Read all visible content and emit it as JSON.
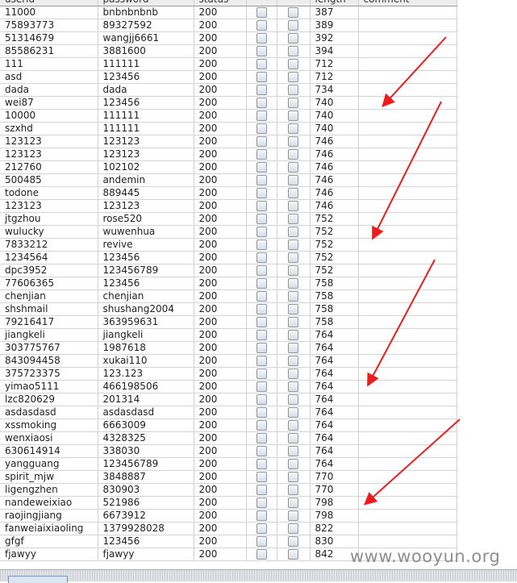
{
  "table": {
    "header": [
      "userid",
      "password",
      "status",
      "",
      "",
      "length",
      "comment"
    ],
    "rows": [
      [
        "11000",
        "bnbnbnbnb",
        "200",
        "387"
      ],
      [
        "75893773",
        "89327592",
        "200",
        "389"
      ],
      [
        "51314679",
        "wangjj6661",
        "200",
        "392"
      ],
      [
        "85586231",
        "3881600",
        "200",
        "394"
      ],
      [
        "111",
        "111111",
        "200",
        "712"
      ],
      [
        "asd",
        "123456",
        "200",
        "712"
      ],
      [
        "dada",
        "dada",
        "200",
        "734"
      ],
      [
        "wei87",
        "123456",
        "200",
        "740"
      ],
      [
        "10000",
        "111111",
        "200",
        "740"
      ],
      [
        "szxhd",
        "111111",
        "200",
        "740"
      ],
      [
        "123123",
        "123123",
        "200",
        "746"
      ],
      [
        "123123",
        "123123",
        "200",
        "746"
      ],
      [
        "212760",
        "102102",
        "200",
        "746"
      ],
      [
        "500485",
        "andemin",
        "200",
        "746"
      ],
      [
        "todone",
        "889445",
        "200",
        "746"
      ],
      [
        "123123",
        "123123",
        "200",
        "746"
      ],
      [
        "jtgzhou",
        "rose520",
        "200",
        "752"
      ],
      [
        "wulucky",
        "wuwenhua",
        "200",
        "752"
      ],
      [
        "7833212",
        "revive",
        "200",
        "752"
      ],
      [
        "1234564",
        "123456",
        "200",
        "752"
      ],
      [
        "dpc3952",
        "123456789",
        "200",
        "752"
      ],
      [
        "77606365",
        "123456",
        "200",
        "758"
      ],
      [
        "chenjian",
        "chenjian",
        "200",
        "758"
      ],
      [
        "shshmail",
        "shushang2004",
        "200",
        "758"
      ],
      [
        "79216417",
        "363959631",
        "200",
        "758"
      ],
      [
        "jiangkeli",
        "jiangkeli",
        "200",
        "764"
      ],
      [
        "303775767",
        "1987618",
        "200",
        "764"
      ],
      [
        "843094458",
        "xukai110",
        "200",
        "764"
      ],
      [
        "375723375",
        "123.123",
        "200",
        "764"
      ],
      [
        "yimao5111",
        "466198506",
        "200",
        "764"
      ],
      [
        "lzc820629",
        "201314",
        "200",
        "764"
      ],
      [
        "asdasdasd",
        "asdasdasd",
        "200",
        "764"
      ],
      [
        "xssmoking",
        "6663009",
        "200",
        "764"
      ],
      [
        "wenxiaosi",
        "4328325",
        "200",
        "764"
      ],
      [
        "630614914",
        "338030",
        "200",
        "764"
      ],
      [
        "yangguang",
        "123456789",
        "200",
        "764"
      ],
      [
        "spirit_mjw",
        "3848887",
        "200",
        "770"
      ],
      [
        "ligengzhen",
        "830903",
        "200",
        "770"
      ],
      [
        "nandeweixiao",
        "521986",
        "200",
        "798"
      ],
      [
        "raojingjiang",
        "6673912",
        "200",
        "798"
      ],
      [
        "fanweiaixiaoling",
        "1379928028",
        "200",
        "822"
      ],
      [
        "gfgf",
        "123456",
        "200",
        "830"
      ],
      [
        "fjawyy",
        "fjawyy",
        "200",
        "842"
      ]
    ]
  },
  "watermark": "www.wooyun.org",
  "colors": {
    "arrow": "#ee1c1c",
    "grid": "#d0d0d0",
    "header_bg": "#eeeeee"
  }
}
